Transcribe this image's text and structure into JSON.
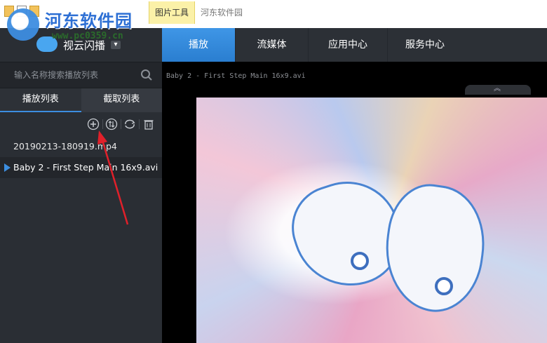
{
  "ribbon": {
    "context_tab": "图片工具",
    "window_title": "河东软件园"
  },
  "watermark": {
    "name": "河东软件园",
    "url": "www.pc0359.cn"
  },
  "app": {
    "brand_name": "视云闪播",
    "brand_caret": "▾"
  },
  "search": {
    "placeholder": "输入名称搜索播放列表"
  },
  "left_tabs": [
    {
      "label": "播放列表"
    },
    {
      "label": "截取列表"
    }
  ],
  "playlist": [
    {
      "name": "20190213-180919.mp4"
    },
    {
      "name": "Baby 2 - First Step Main 16x9.avi",
      "playing": true
    }
  ],
  "nav": [
    {
      "label": "播放"
    },
    {
      "label": "流媒体"
    },
    {
      "label": "应用中心"
    },
    {
      "label": "服务中心"
    }
  ],
  "player": {
    "file_title": "Baby 2 - First Step Main 16x9.avi",
    "collapse_glyph": "︽"
  },
  "colors": {
    "accent": "#3c8ee0",
    "annotation_arrow": "#e0202a"
  },
  "icons": {
    "add": "add-icon",
    "sort": "sort-icon",
    "loop": "loop-icon",
    "delete": "trash-icon",
    "search": "search-icon"
  }
}
